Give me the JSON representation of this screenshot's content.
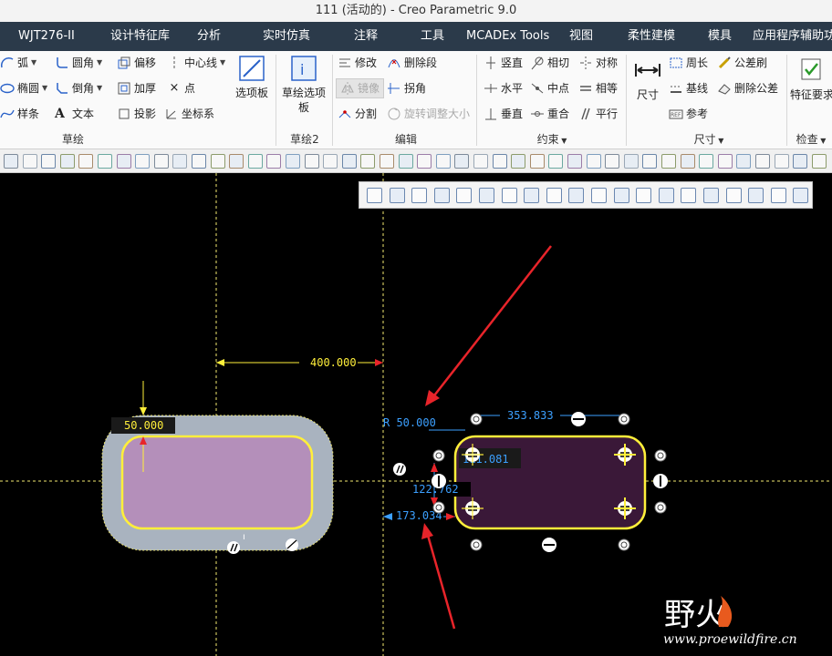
{
  "window": {
    "title": "111 (活动的) - Creo Parametric 9.0"
  },
  "menu": [
    "WJT276-II",
    "设计特征库",
    "分析",
    "实时仿真",
    "注释",
    "工具",
    "MCADEx Tools",
    "视图",
    "柔性建模",
    "模具",
    "应用程序辅助功"
  ],
  "ribbon": {
    "sketch": {
      "arc": "弧",
      "fillet": "圆角",
      "offset": "偏移",
      "centerline": "中心线",
      "ellipse": "椭圆",
      "chamfer": "倒角",
      "thicken": "加厚",
      "point": "点",
      "spline": "样条",
      "text": "文本",
      "project": "投影",
      "coordsys": "坐标系",
      "palette": "选项板",
      "group": "草绘"
    },
    "sketch2": {
      "sketch_palette": "草绘选项板",
      "group": "草绘2"
    },
    "edit": {
      "modify": "修改",
      "delete_segment": "删除段",
      "mirror": "镜像",
      "corner": "拐角",
      "divide": "分割",
      "rotate_resize": "旋转调整大小",
      "group": "编辑"
    },
    "constrain": {
      "vertical": "竖直",
      "tangent": "相切",
      "symmetric": "对称",
      "horizontal": "水平",
      "midpoint": "中点",
      "equal": "相等",
      "perpendicular": "垂直",
      "coincident": "重合",
      "parallel": "平行",
      "group": "约束"
    },
    "dimension": {
      "dimension": "尺寸",
      "perimeter": "周长",
      "tolerance_brush": "公差刷",
      "baseline": "基线",
      "delete_tolerance": "删除公差",
      "reference": "参考",
      "group": "尺寸"
    },
    "inspect": {
      "feature_req": "特征要求",
      "group": "检查"
    }
  },
  "dimensions": {
    "d400": "400.000",
    "left_radius": "50.000",
    "right_radius": "R 50.000",
    "right_width": "353.833",
    "right_height": "173.034",
    "right_a": "111.081",
    "right_b": "122.762"
  },
  "watermark": {
    "brand": "野火",
    "url": "www.proewildfire.cn"
  },
  "colors": {
    "menubar": "#2b3a4a",
    "sketch": "#ffef3a",
    "fill_left": "#b48fba",
    "fill_right": "#3a1838",
    "dim": "#3ca0ff",
    "arrow": "#e8242a"
  }
}
